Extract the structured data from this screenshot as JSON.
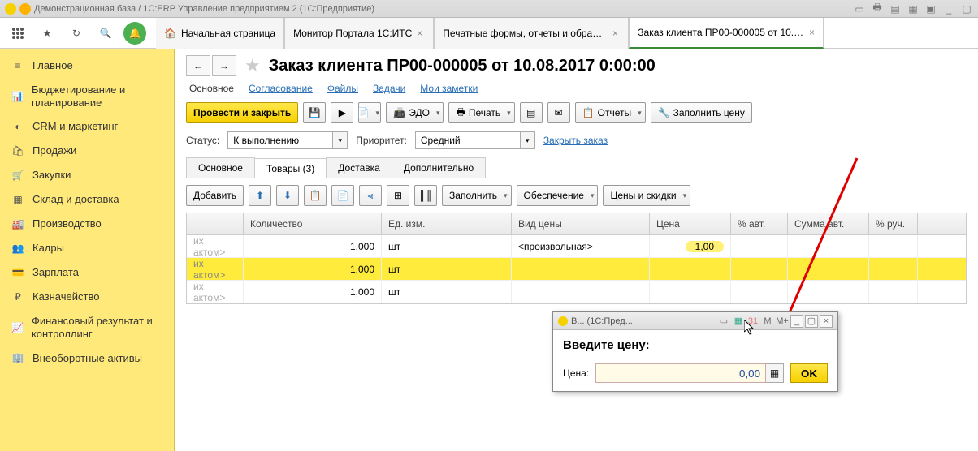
{
  "title": "Демонстрационная база / 1С:ERP Управление предприятием 2  (1С:Предприятие)",
  "tabs": {
    "home": "Начальная страница",
    "t1": "Монитор Портала 1С:ИТС",
    "t2": "Печатные формы, отчеты и обработки",
    "t3": "Заказ клиента ПР00-000005 от 10.08.2017 0:00:00"
  },
  "sidebar": [
    "Главное",
    "Бюджетирование и планирование",
    "CRM и маркетинг",
    "Продажи",
    "Закупки",
    "Склад и доставка",
    "Производство",
    "Кадры",
    "Зарплата",
    "Казначейство",
    "Финансовый результат и контроллинг",
    "Внеоборотные активы"
  ],
  "doc": {
    "title": "Заказ клиента ПР00-000005 от 10.08.2017 0:00:00",
    "links": {
      "main": "Основное",
      "approve": "Согласование",
      "files": "Файлы",
      "tasks": "Задачи",
      "notes": "Мои заметки"
    },
    "btn_post_close": "Провести и закрыть",
    "btn_edo": "ЭДО",
    "btn_print": "Печать",
    "btn_reports": "Отчеты",
    "btn_fill_price": "Заполнить цену",
    "status_label": "Статус:",
    "status_val": "К выполнению",
    "priority_label": "Приоритет:",
    "priority_val": "Средний",
    "close_order": "Закрыть заказ",
    "subtabs": {
      "main": "Основное",
      "goods": "Товары (3)",
      "delivery": "Доставка",
      "extra": "Дополнительно"
    },
    "rowbtns": {
      "add": "Добавить",
      "fill": "Заполнить",
      "supply": "Обеспечение",
      "prices": "Цены и скидки"
    },
    "cols": {
      "qty": "Количество",
      "unit": "Ед. изм.",
      "ptype": "Вид цены",
      "price": "Цена",
      "pauto": "% авт.",
      "sauto": "Сумма авт.",
      "pman": "% руч."
    },
    "rows": [
      {
        "name": "их актом>",
        "qty": "1,000",
        "unit": "шт",
        "ptype": "<произвольная>",
        "price": "1,00"
      },
      {
        "name": "их актом>",
        "qty": "1,000",
        "unit": "шт",
        "ptype": "",
        "price": ""
      },
      {
        "name": "их актом>",
        "qty": "1,000",
        "unit": "шт",
        "ptype": "",
        "price": ""
      }
    ]
  },
  "modal": {
    "title": "В...  (1С:Пред...",
    "heading": "Введите цену:",
    "price_label": "Цена:",
    "price_val": "0,00",
    "ok": "OK"
  }
}
